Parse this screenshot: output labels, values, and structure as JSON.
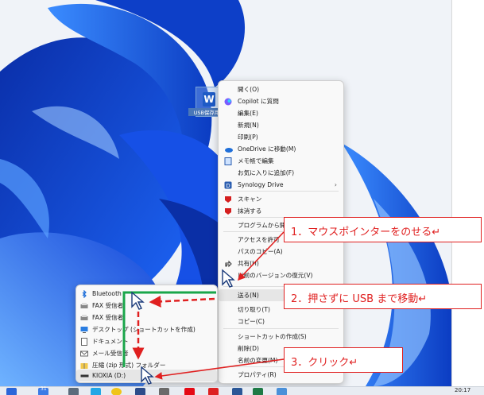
{
  "desktop": {
    "file_label": "USB保存用",
    "accent_color": "#2f6fe0"
  },
  "context_menu": {
    "items": [
      {
        "label": "開く(O)",
        "icon": "none"
      },
      {
        "label": "Copilot に質問",
        "icon": "copilot-icon"
      },
      {
        "label": "編集(E)",
        "icon": "none"
      },
      {
        "label": "新規(N)",
        "icon": "none"
      },
      {
        "label": "印刷(P)",
        "icon": "none"
      },
      {
        "label": "OneDrive に移動(M)",
        "icon": "onedrive-icon"
      },
      {
        "label": "メモ帳で編集",
        "icon": "notepad-icon"
      },
      {
        "label": "お気に入りに追加(F)",
        "icon": "none"
      },
      {
        "label": "Synology Drive",
        "icon": "synology-icon"
      },
      {
        "label": "スキャン",
        "icon": "mcafee-icon"
      },
      {
        "label": "抹消する",
        "icon": "mcafee-icon"
      },
      {
        "label": "プログラムから開く",
        "icon": "none"
      },
      {
        "label": "アクセスを許可",
        "icon": "none"
      },
      {
        "label": "パスのコピー(A)",
        "icon": "none"
      },
      {
        "label": "共有(H)",
        "icon": "share-icon"
      },
      {
        "label": "以前のバージョンの復元(V)",
        "icon": "none"
      },
      {
        "label": "送る(N)",
        "icon": "none"
      },
      {
        "label": "切り取り(T)",
        "icon": "none"
      },
      {
        "label": "コピー(C)",
        "icon": "none"
      },
      {
        "label": "ショートカットの作成(S)",
        "icon": "none"
      },
      {
        "label": "削除(D)",
        "icon": "none"
      },
      {
        "label": "名前の変更(M)",
        "icon": "none"
      },
      {
        "label": "プロパティ(R)",
        "icon": "none"
      }
    ]
  },
  "send_to_menu": {
    "items": [
      {
        "label": "Bluetooth",
        "icon": "bluetooth-icon"
      },
      {
        "label": "FAX 受信者",
        "icon": "fax-icon"
      },
      {
        "label": "FAX 受信者",
        "icon": "fax-icon"
      },
      {
        "label": "デスクトップ (ショートカットを作成)",
        "icon": "desktop-icon"
      },
      {
        "label": "ドキュメント",
        "icon": "documents-icon"
      },
      {
        "label": "メール受信者",
        "icon": "mail-icon"
      },
      {
        "label": "圧縮 (zip 形式) フォルダー",
        "icon": "zip-folder-icon"
      },
      {
        "label": "KIOXIA (D:)",
        "icon": "usb-drive-icon"
      }
    ]
  },
  "annotations": {
    "step1": "1．マウスポインターをのせる↵",
    "step2": "2．押さずに USB まで移動↵",
    "step3": "3．クリック↵",
    "colors": {
      "red": "#e02020",
      "green": "#1aa64a"
    }
  },
  "taskbar": {
    "time": "20:17",
    "badge_count": "31"
  }
}
